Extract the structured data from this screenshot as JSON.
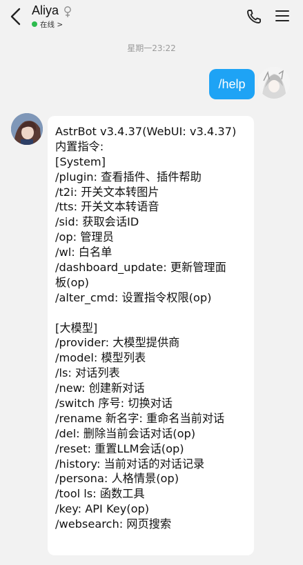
{
  "header": {
    "contact_name": "Aliya",
    "status": "在线 >",
    "status_color": "#2dbb4e"
  },
  "icons": {
    "back": "chevron-left-icon",
    "gender": "female-symbol-icon",
    "phone": "phone-icon",
    "menu": "hamburger-menu-icon"
  },
  "timestamp": "星期一23:22",
  "messages": [
    {
      "from": "self",
      "text": "/help",
      "bubble_color": "#1ea3f5"
    },
    {
      "from": "peer",
      "bubble_color": "#ffffff",
      "lines": [
        "AstrBot v3.4.37(WebUI: v3.4.37)",
        "内置指令:",
        "[System]",
        "/plugin: 查看插件、插件帮助",
        "/t2i: 开关文本转图片",
        "/tts: 开关文本转语音",
        "/sid: 获取会话ID",
        "/op: 管理员",
        "/wl: 白名单",
        "/dashboard_update: 更新管理面",
        "板(op)",
        "/alter_cmd: 设置指令权限(op)",
        "",
        "[大模型]",
        "/provider: 大模型提供商",
        "/model: 模型列表",
        "/ls: 对话列表",
        "/new: 创建新对话",
        "/switch 序号: 切换对话",
        "/rename 新名字: 重命名当前对话",
        "/del: 删除当前会话对话(op)",
        "/reset: 重置LLM会话(op)",
        "/history: 当前对话的对话记录",
        "/persona: 人格情景(op)",
        "/tool ls: 函数工具",
        "/key: API Key(op)",
        "/websearch: 网页搜索"
      ]
    }
  ]
}
